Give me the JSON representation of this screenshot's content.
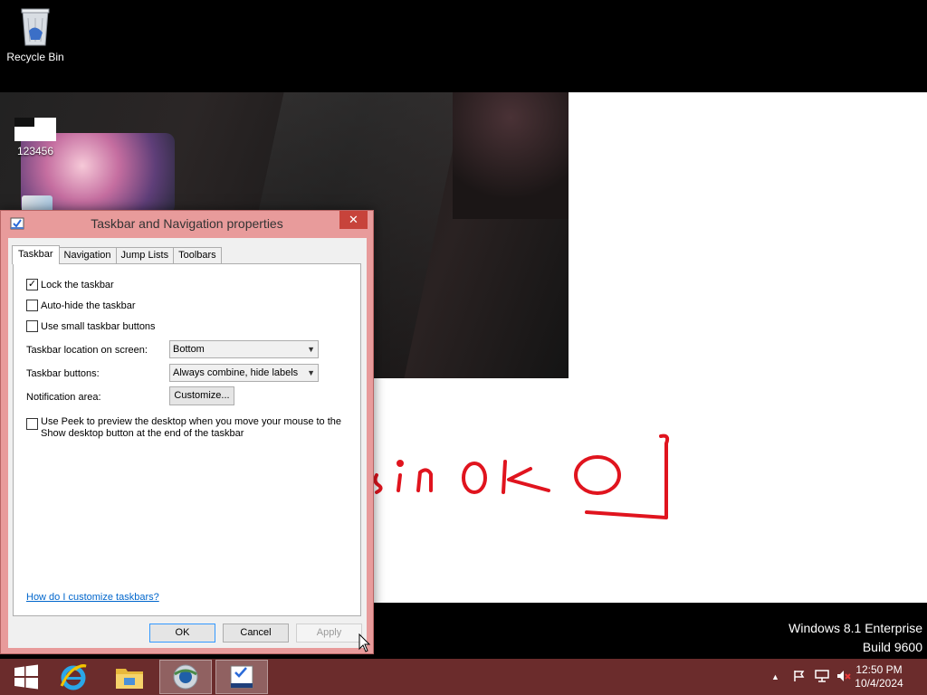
{
  "desktop": {
    "icons": [
      {
        "label": "Recycle Bin",
        "icon": "recycle-bin-icon"
      },
      {
        "label": "123456",
        "icon": "file-icon"
      }
    ],
    "handwriting_text": "sinoko",
    "watermark": {
      "line1": "Windows 8.1 Enterprise",
      "line2": "Build 9600"
    }
  },
  "dialog": {
    "title": "Taskbar and Navigation properties",
    "close_glyph": "✕",
    "tabs": [
      {
        "label": "Taskbar",
        "active": true
      },
      {
        "label": "Navigation",
        "active": false
      },
      {
        "label": "Jump Lists",
        "active": false
      },
      {
        "label": "Toolbars",
        "active": false
      }
    ],
    "checkboxes": {
      "lock": {
        "label": "Lock the taskbar",
        "checked": true
      },
      "autohide": {
        "label": "Auto-hide the taskbar",
        "checked": false
      },
      "small": {
        "label": "Use small taskbar buttons",
        "checked": false
      }
    },
    "location": {
      "label": "Taskbar location on screen:",
      "value": "Bottom"
    },
    "buttons_setting": {
      "label": "Taskbar buttons:",
      "value": "Always combine, hide labels"
    },
    "notification": {
      "label": "Notification area:",
      "button": "Customize..."
    },
    "peek": {
      "checked": false,
      "line1": "Use Peek to preview the desktop when you move your mouse to the",
      "line2": "Show desktop button at the end of the taskbar"
    },
    "help_link": "How do I customize taskbars?",
    "footer": {
      "ok": "OK",
      "cancel": "Cancel",
      "apply": "Apply"
    }
  },
  "taskbar": {
    "buttons": [
      {
        "name": "start",
        "icon": "windows-logo-icon"
      },
      {
        "name": "internet-explorer",
        "icon": "internet-explorer-icon"
      },
      {
        "name": "file-explorer",
        "icon": "folder-icon"
      },
      {
        "name": "browser",
        "icon": "browser-globe-icon",
        "active": true
      },
      {
        "name": "taskbar-properties",
        "icon": "taskbar-properties-icon",
        "active": true
      }
    ],
    "tray": {
      "icons": [
        "show-hidden-icons-icon",
        "action-center-flag-icon",
        "network-icon",
        "volume-muted-icon"
      ],
      "time": "12:50 PM",
      "date": "10/4/2024"
    }
  },
  "colors": {
    "window_frame": "#e89b9b",
    "taskbar": "#6b2c2c",
    "close_button": "#c7433b",
    "handwriting": "#e0141e"
  }
}
